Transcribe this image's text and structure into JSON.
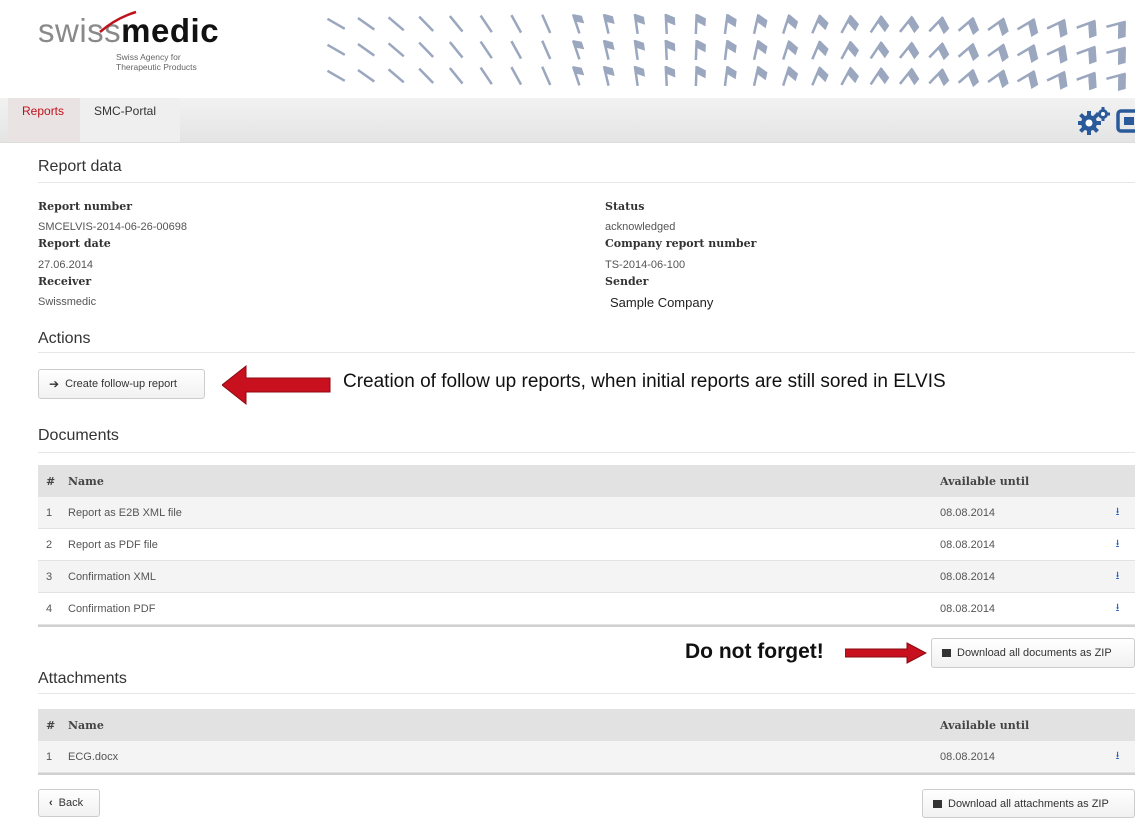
{
  "logo": {
    "word_part1": "swiss",
    "word_part2": "medic",
    "subtitle_line1": "Swiss Agency for",
    "subtitle_line2": "Therapeutic Products"
  },
  "nav": {
    "tabs": [
      {
        "label": "Reports",
        "active": true
      },
      {
        "label": "SMC-Portal",
        "active": false
      }
    ],
    "icons": [
      "gears-icon",
      "logout-icon"
    ],
    "active_color": "#c0101b"
  },
  "report_data": {
    "title": "Report data",
    "left": [
      {
        "label": "Report number",
        "value": "SMCELVIS-2014-06-26-00698"
      },
      {
        "label": "Report date",
        "value": "27.06.2014"
      },
      {
        "label": "Receiver",
        "value": "Swissmedic"
      }
    ],
    "right": [
      {
        "label": "Status",
        "value": "acknowledged"
      },
      {
        "label": "Company report number",
        "value": "TS-2014-06-100"
      },
      {
        "label": "Sender",
        "value": "Sample Company"
      }
    ]
  },
  "actions": {
    "title": "Actions",
    "follow_up_button": "Create follow-up report",
    "annotation": "Creation of follow up reports, when initial reports are still sored in ELVIS"
  },
  "documents": {
    "title": "Documents",
    "headers": [
      "#",
      "Name",
      "Available until"
    ],
    "rows": [
      {
        "num": "1",
        "name": "Report as E2B XML file",
        "date": "08.08.2014"
      },
      {
        "num": "2",
        "name": "Report as PDF file",
        "date": "08.08.2014"
      },
      {
        "num": "3",
        "name": "Confirmation XML",
        "date": "08.08.2014"
      },
      {
        "num": "4",
        "name": "Confirmation PDF",
        "date": "08.08.2014"
      }
    ],
    "download_zip_button": "Download all documents as ZIP",
    "annotation": "Do not forget!"
  },
  "attachments": {
    "title": "Attachments",
    "headers": [
      "#",
      "Name",
      "Available until"
    ],
    "rows": [
      {
        "num": "1",
        "name": "ECG.docx",
        "date": "08.08.2014"
      }
    ],
    "download_zip_button": "Download all attachments as ZIP"
  },
  "back_button": "Back",
  "colors": {
    "arrow_red": "#c8101e",
    "download_blue": "#2b66b4"
  }
}
